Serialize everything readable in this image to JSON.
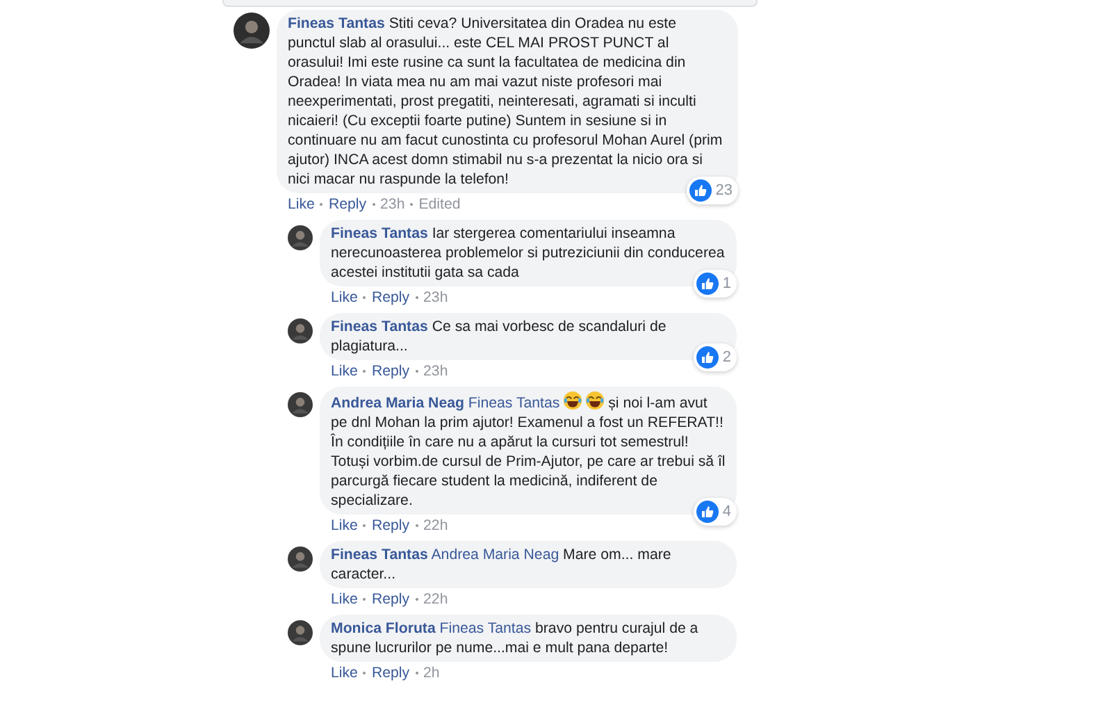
{
  "comments": [
    {
      "author": "Fineas Tantas",
      "reply": false,
      "text": "Stiti ceva? Universitatea din Oradea nu este punctul slab al orasului... este CEL MAI PROST PUNCT al orasului! Imi este rusine ca sunt la facultatea de medicina din Oradea! In viata mea nu am mai vazut niste profesori mai neexperimentati, prost pregatiti, neinteresati, agramati si inculti nicaieri! (Cu exceptii foarte putine) Suntem in sesiune si in continuare nu am facut cunostinta cu profesorul Mohan Aurel (prim ajutor) INCA acest domn stimabil nu s-a prezentat la nicio ora si nici macar nu raspunde la telefon!",
      "reactions": "23",
      "like": "Like",
      "reply_label": "Reply",
      "time": "23h",
      "edited": "Edited"
    },
    {
      "author": "Fineas Tantas",
      "reply": true,
      "text": "Iar stergerea comentariului inseamna nerecunoasterea problemelor si putreziciunii din conducerea acestei institutii gata sa cada",
      "reactions": "1",
      "like": "Like",
      "reply_label": "Reply",
      "time": "23h"
    },
    {
      "author": "Fineas Tantas",
      "reply": true,
      "text": "Ce sa mai vorbesc de scandaluri de plagiatura...",
      "reactions": "2",
      "like": "Like",
      "reply_label": "Reply",
      "time": "23h"
    },
    {
      "author": "Andrea Maria Neag",
      "reply": true,
      "mention": "Fineas Tantas",
      "emojis": [
        {
          "kind": "laughing"
        },
        {
          "kind": "laughing"
        }
      ],
      "text": "și noi l-am avut pe dnl Mohan la prim ajutor! Examenul a fost un REFERAT!! În condițiile în care nu a apărut la cursuri tot semestrul! Totuși vorbim.de cursul de Prim-Ajutor, pe care ar trebui să îl parcurgă fiecare student la medicină, indiferent de specializare.",
      "reactions": "4",
      "like": "Like",
      "reply_label": "Reply",
      "time": "22h"
    },
    {
      "author": "Fineas Tantas",
      "reply": true,
      "mention": "Andrea Maria Neag",
      "text": "Mare om... mare caracter...",
      "like": "Like",
      "reply_label": "Reply",
      "time": "22h"
    },
    {
      "author": "Monica Floruta",
      "reply": true,
      "mention": "Fineas Tantas",
      "text": "bravo pentru curajul de a spune lucrurilor pe nume...mai e mult pana departe!",
      "like": "Like",
      "reply_label": "Reply",
      "time": "2h"
    }
  ]
}
